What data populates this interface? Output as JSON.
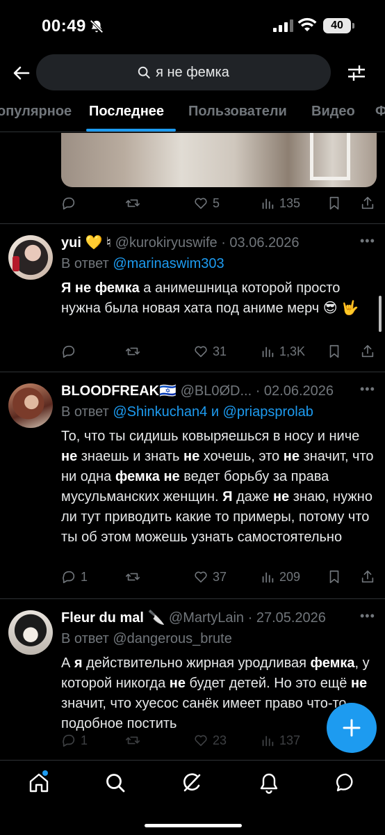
{
  "status_bar": {
    "time": "00:49",
    "battery": "40"
  },
  "search": {
    "query": "я не фемка"
  },
  "tabs": [
    {
      "label": "опулярное",
      "active": false
    },
    {
      "label": "Последнее",
      "active": true
    },
    {
      "label": "Пользователи",
      "active": false
    },
    {
      "label": "Видео",
      "active": false
    },
    {
      "label": "Ф",
      "active": false
    }
  ],
  "top_tweet_actions": {
    "replies": "",
    "reposts": "",
    "likes": "5",
    "views": "135"
  },
  "tweets": [
    {
      "name": "yui",
      "name_suffix": " 💛 ♮",
      "handle": " @kurokiryuswife · 03.06.2026",
      "reply_prefix": "В ответ ",
      "reply_to": "@marinaswim303",
      "body_html": "<b>Я не фемка</b> а анимешница которой просто нужна была новая хата под аниме мерч 😎 🤟",
      "replies": "",
      "reposts": "",
      "likes": "31",
      "views": "1,3K"
    },
    {
      "name": "BLOODFREAK",
      "name_suffix": "🇮🇱",
      "handle": " @BL0ØD... · 02.06.2026",
      "reply_prefix": "В ответ ",
      "reply_to": "@Shinkuchan4 и @priapsprolab",
      "body_html": "То, что ты сидишь ковыряешься в носу и ниче <b>не</b> знаешь и знать <b>не</b> хочешь, это <b>не</b> значит, что ни одна <b>фемка не</b> ведет борьбу за права мусульманских женщин. <b>Я</b> даже <b>не</b> знаю, нужно ли тут приводить какие то примеры, потому что ты об этом можешь узнать самостоятельно",
      "replies": "1",
      "reposts": "",
      "likes": "37",
      "views": "209"
    },
    {
      "name": "Fleur du mal",
      "name_suffix": " 🔪",
      "handle": " @MartyLain · 27.05.2026",
      "reply_prefix": "В ответ ",
      "reply_to": "@dangerous_brute",
      "body_html": "А <b>я</b> действительно жирная уродливая <b>фемка</b>, у которой никогда <b>не</b> будет детей. Но это ещё <b>не</b> значит, что хуесос санёк имеет право что-то подобное постить",
      "replies": "1",
      "reposts": "",
      "likes": "23",
      "views": "137"
    }
  ],
  "colors": {
    "accent": "#1d9bf0",
    "muted": "#71767b",
    "divider": "#2f3336",
    "background": "#000000"
  },
  "icons": [
    "back-arrow-icon",
    "search-icon",
    "filter-sliders-icon",
    "reply-icon",
    "repost-icon",
    "like-icon",
    "views-icon",
    "bookmark-icon",
    "share-icon",
    "home-icon",
    "explore-icon",
    "grok-icon",
    "notifications-icon",
    "messages-icon",
    "compose-plus-icon"
  ]
}
